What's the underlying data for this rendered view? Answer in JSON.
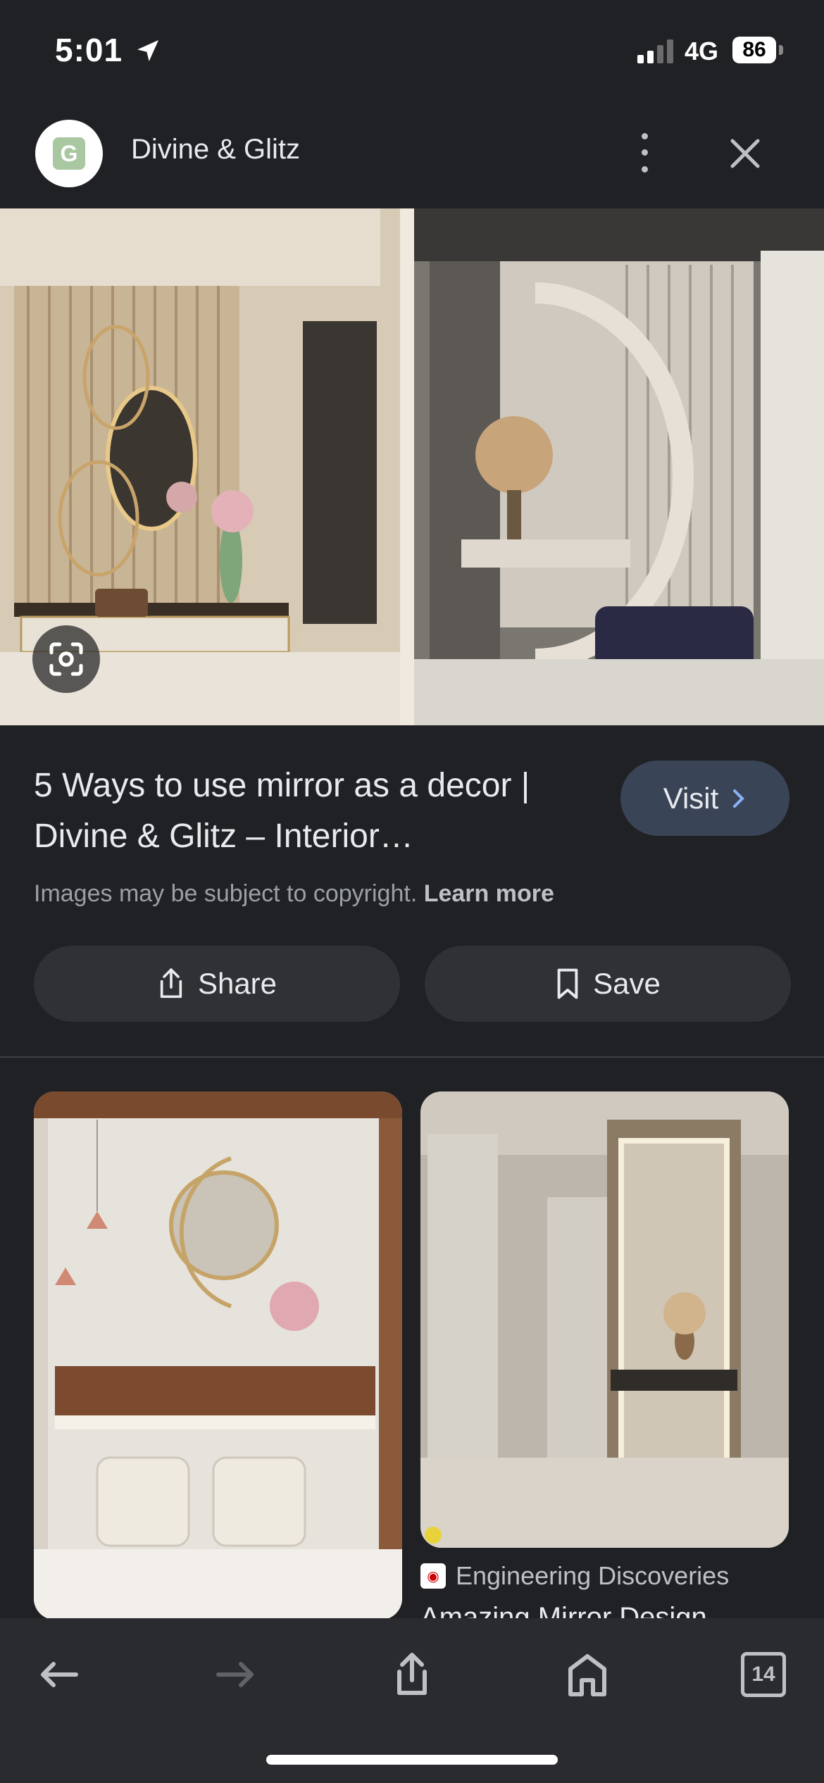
{
  "status_bar": {
    "time": "5:01",
    "network": "4G",
    "battery": "86"
  },
  "header": {
    "avatar_letter": "G",
    "site_name": "Divine & Glitz"
  },
  "result": {
    "title": "5 Ways to use mirror as a decor | Divine & Glitz – Interior…",
    "visit_label": "Visit",
    "copyright_text": "Images may be subject to copyright.",
    "learn_more": "Learn more",
    "share_label": "Share",
    "save_label": "Save"
  },
  "related": [
    {
      "source": "",
      "title": ""
    },
    {
      "source": "Engineering Discoveries",
      "title": "Amazing Mirror Design…"
    }
  ],
  "toolbar": {
    "tabs_count": "14"
  },
  "colors": {
    "background": "#202124",
    "visit_button": "#394457",
    "pill_button": "#303134"
  }
}
